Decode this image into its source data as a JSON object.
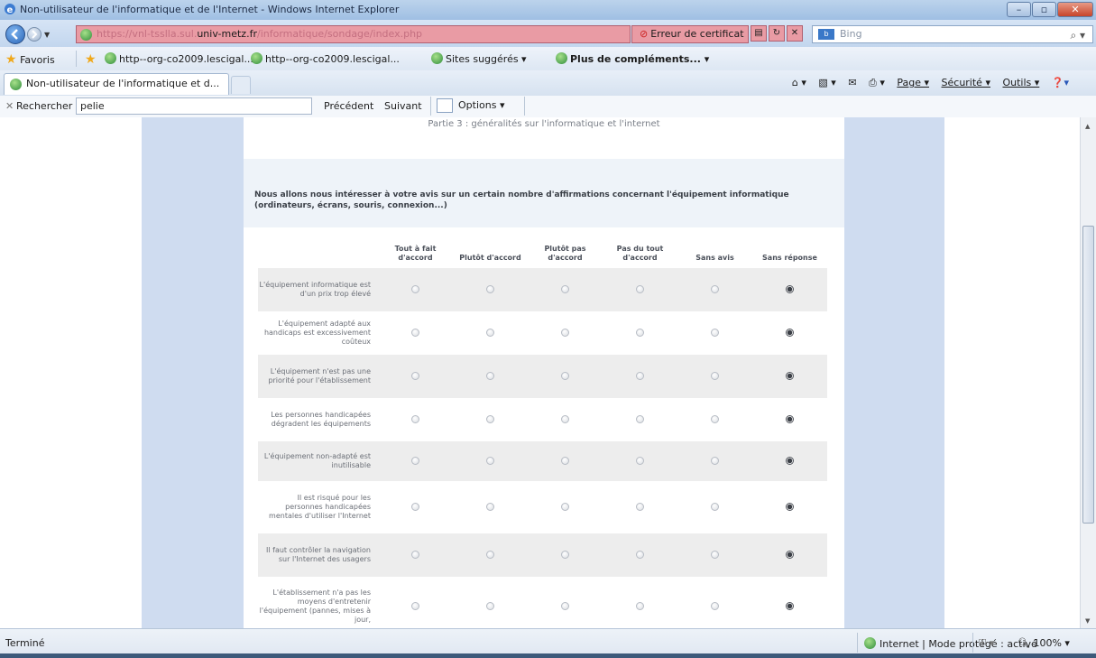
{
  "window": {
    "title": "Non-utilisateur de l'informatique et de l'Internet - Windows Internet Explorer"
  },
  "address": {
    "url_prefix": "https://vnl-tsslla.sul.",
    "url_host": "univ-metz.fr",
    "url_suffix": "/informatique/sondage/index.php",
    "cert_error": "Erreur de certificat",
    "search_placeholder": "Bing"
  },
  "favorites": {
    "favoris": "Favoris",
    "fav1": "http--org-co2009.lescigal...",
    "fav2": "http--org-co2009.lescigal...",
    "suggested": "Sites suggérés ▾",
    "more": "Plus de compléments... ▾"
  },
  "tabs": [
    {
      "label": "Non-utilisateur de l'informatique et d..."
    }
  ],
  "command_bar": {
    "page": "Page ▾",
    "securite": "Sécurité ▾",
    "outils": "Outils ▾"
  },
  "findbar": {
    "label": "Rechercher :",
    "value": "pelie",
    "previous": "Précédent",
    "next": "Suivant",
    "options": "Options ▾"
  },
  "survey": {
    "part_label": "Partie 3 : généralités sur l'informatique et l'internet",
    "intro": "Nous allons nous intéresser à votre avis sur un certain nombre d'affirmations concernant l'équipement informatique (ordinateurs, écrans, souris, connexion...)",
    "columns": [
      "Tout à fait d'accord",
      "Plutôt d'accord",
      "Plutôt pas d'accord",
      "Pas du tout d'accord",
      "Sans avis",
      "Sans réponse"
    ],
    "rows": [
      {
        "question": "L'équipement informatique est d'un prix trop élevé",
        "selected": 5
      },
      {
        "question": "L'équipement adapté aux handicaps est excessivement coûteux",
        "selected": 5
      },
      {
        "question": "L'équipement n'est pas une priorité pour l'établissement",
        "selected": 5
      },
      {
        "question": "Les personnes handicapées dégradent les équipements",
        "selected": 5
      },
      {
        "question": "L'équipement non-adapté est inutilisable",
        "selected": 5
      },
      {
        "question": "Il est risqué pour les personnes handicapées mentales d'utiliser l'Internet",
        "selected": 5
      },
      {
        "question": "Il faut contrôler la navigation sur l'Internet des usagers",
        "selected": 5
      },
      {
        "question": "L'établissement n'a pas les moyens d'entretenir l'équipement (pannes, mises à jour,",
        "selected": 5
      }
    ]
  },
  "status": {
    "left": "Terminé",
    "zone": "Internet | Mode protégé : activé",
    "zoom": "100%"
  },
  "colors": {
    "accent_blue": "#cfdcf0",
    "cert_error_pink": "#e99ba4",
    "row_shade": "#ededed"
  }
}
